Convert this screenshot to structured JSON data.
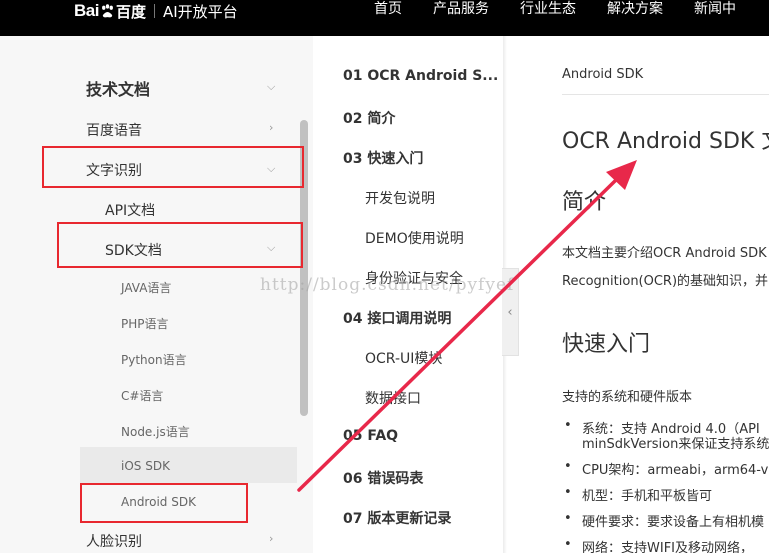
{
  "topbar": {
    "logo_bai": "Bai",
    "logo_du": "百度",
    "logo_product": "AI开放平台",
    "nav": [
      "首页",
      "产品服务",
      "行业生态",
      "解决方案",
      "新闻中"
    ]
  },
  "sidebar": {
    "heading": "技术文档",
    "items": {
      "voice": "百度语音",
      "ocr": "文字识别",
      "api_doc": "API文档",
      "sdk_doc": "SDK文档",
      "java": "JAVA语言",
      "php": "PHP语言",
      "python": "Python语言",
      "csharp": "C#语言",
      "nodejs": "Node.js语言",
      "ios": "iOS SDK",
      "android": "Android SDK",
      "face": "人脸识别"
    }
  },
  "toc": {
    "items": [
      "01 OCR Android S...",
      "02 简介",
      "03 快速入门",
      "开发包说明",
      "DEMO使用说明",
      "身份验证与安全",
      "04 接口调用说明",
      "OCR-UI模块",
      "数据接口",
      "05 FAQ",
      "06 错误码表",
      "07 版本更新记录"
    ],
    "collapse_glyph": "‹"
  },
  "main": {
    "breadcrumb": "Android SDK",
    "title": "OCR Android SDK 文",
    "intro_heading": "简介",
    "intro_line1": "本文档主要介绍OCR Android SDK",
    "intro_line2": "Recognition(OCR)的基础知识，并",
    "quick_heading": "快速入门",
    "support_label": "支持的系统和硬件版本",
    "bullets": [
      "系统：支持 Android 4.0（API",
      "minSdkVersion来保证支持系统",
      "CPU架构：armeabi，arm64-v",
      "机型：手机和平板皆可",
      "硬件要求：要求设备上有相机模",
      "网络：支持WIFI及移动网络，"
    ]
  },
  "watermark": "http://blog.csdn.net/pyfyef",
  "colors": {
    "highlight": "#e8282f",
    "arrow": "#e8284a",
    "topbar": "#000000"
  }
}
